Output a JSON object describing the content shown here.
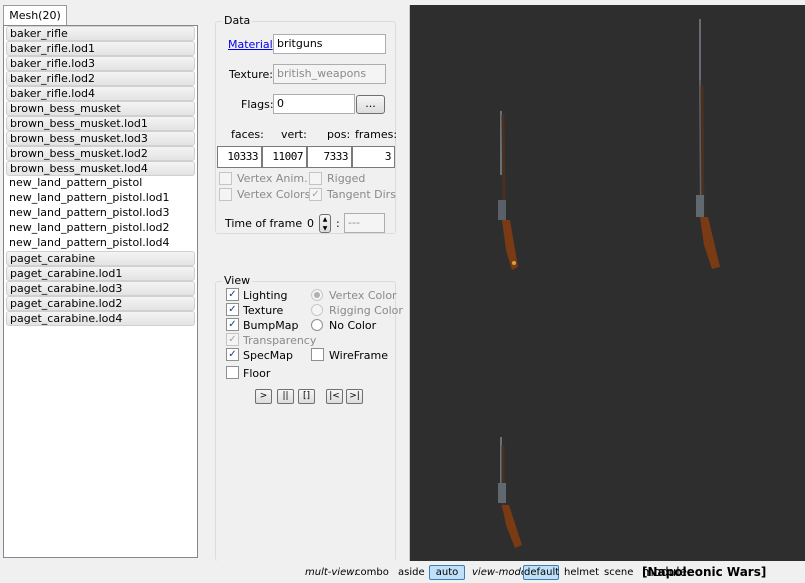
{
  "tab": {
    "label": "Mesh(20)"
  },
  "meshes": [
    {
      "name": "baker_rifle",
      "hl": true
    },
    {
      "name": "baker_rifle.lod1",
      "hl": true
    },
    {
      "name": "baker_rifle.lod3",
      "hl": true
    },
    {
      "name": "baker_rifle.lod2",
      "hl": true
    },
    {
      "name": "baker_rifle.lod4",
      "hl": true
    },
    {
      "name": "brown_bess_musket",
      "hl": true
    },
    {
      "name": "brown_bess_musket.lod1",
      "hl": true
    },
    {
      "name": "brown_bess_musket.lod3",
      "hl": true
    },
    {
      "name": "brown_bess_musket.lod2",
      "hl": true
    },
    {
      "name": "brown_bess_musket.lod4",
      "hl": true
    },
    {
      "name": "new_land_pattern_pistol",
      "hl": false
    },
    {
      "name": "new_land_pattern_pistol.lod1",
      "hl": false
    },
    {
      "name": "new_land_pattern_pistol.lod3",
      "hl": false
    },
    {
      "name": "new_land_pattern_pistol.lod2",
      "hl": false
    },
    {
      "name": "new_land_pattern_pistol.lod4",
      "hl": false
    },
    {
      "name": "paget_carabine",
      "hl": true
    },
    {
      "name": "paget_carabine.lod1",
      "hl": true
    },
    {
      "name": "paget_carabine.lod3",
      "hl": true
    },
    {
      "name": "paget_carabine.lod2",
      "hl": true
    },
    {
      "name": "paget_carabine.lod4",
      "hl": true
    }
  ],
  "data": {
    "title": "Data",
    "material_label": "Material",
    "colon": ":",
    "material_value": "britguns",
    "texture_label": "Texture:",
    "texture_value": "british_weapons",
    "flags_label": "Flags:",
    "flags_value": "0",
    "flags_button": "...",
    "stats_headers": {
      "faces": "faces:",
      "vert": "vert:",
      "pos": "pos:",
      "frames": "frames:"
    },
    "stats": {
      "faces": "10333",
      "vert": "11007",
      "pos": "7333",
      "frames": "3"
    },
    "vertex_anim": "Vertex Anim.",
    "rigged": "Rigged",
    "vertex_colors": "Vertex Colors",
    "tangent_dirs": "Tangent Dirs",
    "time_label": "Time of frame",
    "time_value": "0",
    "time_sep": ":",
    "time_right": "---"
  },
  "view": {
    "title": "View",
    "lighting": "Lighting",
    "texture": "Texture",
    "bumpmap": "BumpMap",
    "transparency": "Transparency",
    "specmap": "SpecMap",
    "floor": "Floor",
    "vertex_color": "Vertex Color",
    "rigging_color": "Rigging Color",
    "no_color": "No Color",
    "wireframe": "WireFrame",
    "play": ">",
    "pause": "||",
    "stop": "[]",
    "first": "|<",
    "last": ">|"
  },
  "status": {
    "multiview_label": "mult-view:",
    "combo": "combo",
    "aside": "aside",
    "auto": "auto",
    "viewmode_label": "view-mode:",
    "default": "default",
    "helmet": "helmet",
    "scene": "scene",
    "module_label": "module:",
    "module_value": "[Napoleonic Wars]"
  },
  "colors": {
    "viewport_bg": "#2e2e2e",
    "link": "#0000ee",
    "active_button": "#bfe0f8"
  }
}
